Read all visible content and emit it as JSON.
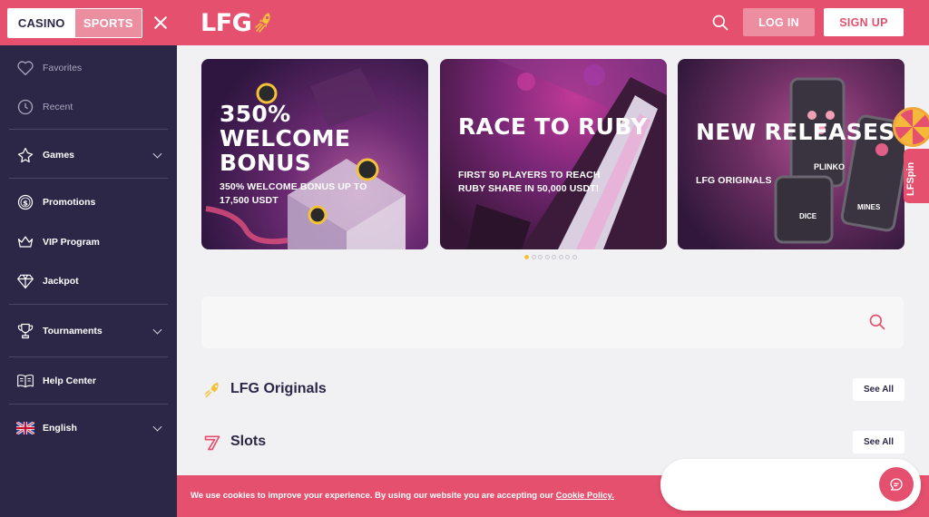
{
  "mode_switch": {
    "casino": "CASINO",
    "sports": "SPORTS"
  },
  "sidebar": {
    "items": [
      {
        "label": "Favorites",
        "icon": "heart-icon"
      },
      {
        "label": "Recent",
        "icon": "clock-icon"
      },
      {
        "label": "Games",
        "icon": "games-icon"
      },
      {
        "label": "Promotions",
        "icon": "dollar-coin-icon"
      },
      {
        "label": "VIP Program",
        "icon": "crown-icon"
      },
      {
        "label": "Jackpot",
        "icon": "diamond-icon"
      },
      {
        "label": "Tournaments",
        "icon": "trophy-icon"
      },
      {
        "label": "Help Center",
        "icon": "book-icon"
      },
      {
        "label": "English",
        "icon": "uk-flag-icon"
      }
    ]
  },
  "header": {
    "logo": "LFG",
    "login": "LOG IN",
    "signup": "SIGN UP"
  },
  "banners": [
    {
      "title": "350% WELCOME BONUS",
      "subtitle": "350% WELCOME BONUS UP TO 17,500 USDT"
    },
    {
      "title": "RACE TO RUBY",
      "subtitle": "FIRST 50 PLAYERS TO REACH RUBY SHARE IN 50,000 USDT!"
    },
    {
      "title": "NEW RELEASES",
      "subtitle": "LFG ORIGINALS"
    }
  ],
  "banner_overlay_labels": {
    "plinko": "PLINKO",
    "dice": "DICE",
    "mines": "MINES"
  },
  "carousel": {
    "total": 8,
    "active": 1
  },
  "search": {
    "placeholder": ""
  },
  "sections": [
    {
      "title": "LFG Originals",
      "see_all": "See All",
      "icon": "rocket-icon"
    },
    {
      "title": "Slots",
      "see_all": "See All",
      "icon": "seven-icon"
    }
  ],
  "cookie": {
    "text": "We use cookies to improve your experience. By using our website you are accepting our",
    "link": "Cookie Policy."
  },
  "lfspin": {
    "label": "LFSpin"
  },
  "colors": {
    "brand": "#e5506e",
    "sidebar_bg": "#2c2747",
    "accent_yellow": "#f4c23a"
  }
}
